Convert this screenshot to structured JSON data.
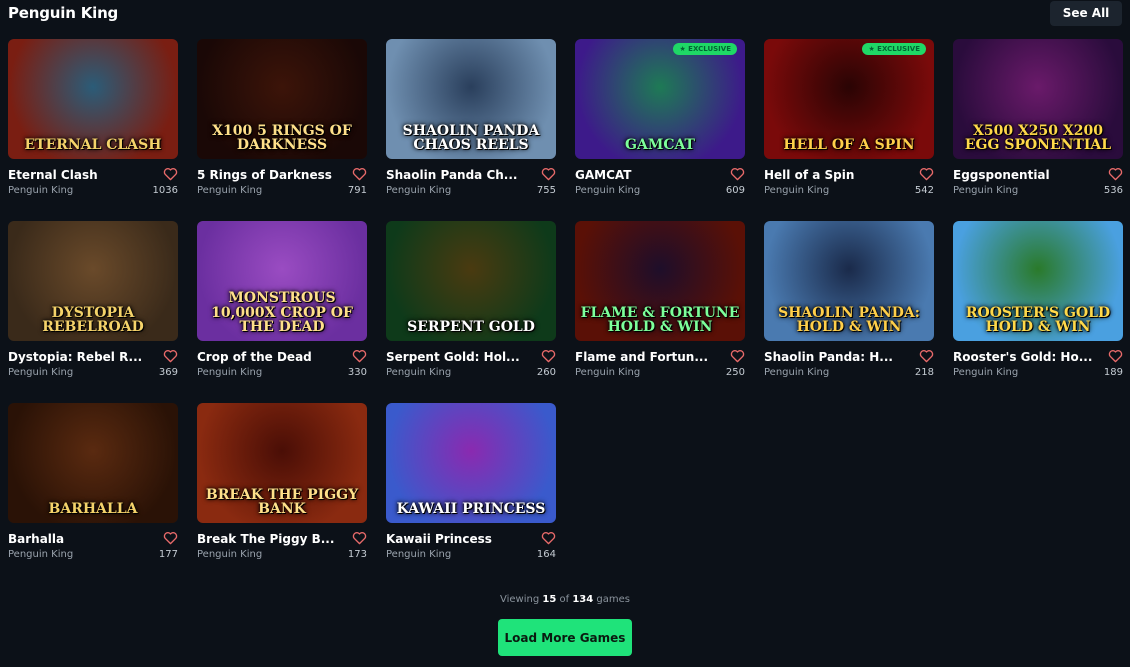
{
  "header": {
    "title": "Penguin King",
    "see_all": "See All"
  },
  "games": [
    {
      "name": "Eternal Clash",
      "provider": "Penguin King",
      "likes": "1036",
      "art_title": "ETERNAL CLASH",
      "bg1": "#7a1e12",
      "bg2": "#2b5c78",
      "exclusive": ""
    },
    {
      "name": "5 Rings of Darkness",
      "provider": "Penguin King",
      "likes": "791",
      "art_title": "X100 5 RINGS OF DARKNESS",
      "bg1": "#1a0806",
      "bg2": "#3c1409",
      "exclusive": ""
    },
    {
      "name": "Shaolin Panda Ch...",
      "provider": "Penguin King",
      "likes": "755",
      "art_title": "SHAOLIN PANDA CHAOS REELS",
      "bg1": "#6f8fb0",
      "bg2": "#2a3f5c",
      "exclusive": ""
    },
    {
      "name": "GAMCAT",
      "provider": "Penguin King",
      "likes": "609",
      "art_title": "GAMCAT",
      "bg1": "#3d1a8a",
      "bg2": "#1e7a55",
      "exclusive": "★ EXCLUSIVE"
    },
    {
      "name": "Hell of a Spin",
      "provider": "Penguin King",
      "likes": "542",
      "art_title": "HELL OF A SPIN",
      "bg1": "#7a0a0a",
      "bg2": "#2a0404",
      "exclusive": "★ EXCLUSIVE"
    },
    {
      "name": "Eggsponential",
      "provider": "Penguin King",
      "likes": "536",
      "art_title": "X500 X250 X200 EGG SPONENTIAL",
      "bg1": "#2a0c3c",
      "bg2": "#6a1a6a",
      "exclusive": ""
    },
    {
      "name": "Dystopia: Rebel R...",
      "provider": "Penguin King",
      "likes": "369",
      "art_title": "DYSTOPIA REBELROAD",
      "bg1": "#3a2a1a",
      "bg2": "#6a4a2a",
      "exclusive": ""
    },
    {
      "name": "Crop of the Dead",
      "provider": "Penguin King",
      "likes": "330",
      "art_title": "MONSTROUS 10,000X CROP OF THE DEAD",
      "bg1": "#6b2fa0",
      "bg2": "#9a4cc2",
      "exclusive": ""
    },
    {
      "name": "Serpent Gold: Hol...",
      "provider": "Penguin King",
      "likes": "260",
      "art_title": "SERPENT GOLD",
      "bg1": "#0e3a1a",
      "bg2": "#4a3a10",
      "exclusive": ""
    },
    {
      "name": "Flame and Fortun...",
      "provider": "Penguin King",
      "likes": "250",
      "art_title": "FLAME & FORTUNE HOLD & WIN",
      "bg1": "#5a1006",
      "bg2": "#1e0e2a",
      "exclusive": ""
    },
    {
      "name": "Shaolin Panda: H...",
      "provider": "Penguin King",
      "likes": "218",
      "art_title": "SHAOLIN PANDA: HOLD & WIN",
      "bg1": "#4a7ab0",
      "bg2": "#1a2a4a",
      "exclusive": ""
    },
    {
      "name": "Rooster's Gold: Ho...",
      "provider": "Penguin King",
      "likes": "189",
      "art_title": "ROOSTER'S GOLD HOLD & WIN",
      "bg1": "#4aa0e0",
      "bg2": "#2a7a2a",
      "exclusive": ""
    },
    {
      "name": "Barhalla",
      "provider": "Penguin King",
      "likes": "177",
      "art_title": "BARHALLA",
      "bg1": "#2a1206",
      "bg2": "#5a2a10",
      "exclusive": ""
    },
    {
      "name": "Break The Piggy B...",
      "provider": "Penguin King",
      "likes": "173",
      "art_title": "BREAK THE PIGGY BANK",
      "bg1": "#8a2a10",
      "bg2": "#4a0e06",
      "exclusive": ""
    },
    {
      "name": "Kawaii Princess",
      "provider": "Penguin King",
      "likes": "164",
      "art_title": "KAWAII PRINCESS",
      "bg1": "#3a5acc",
      "bg2": "#8a2ab0",
      "exclusive": ""
    }
  ],
  "footer": {
    "viewing_prefix": "Viewing",
    "shown": "15",
    "of": "of",
    "total": "134",
    "suffix": "games",
    "load_more": "Load More Games"
  }
}
